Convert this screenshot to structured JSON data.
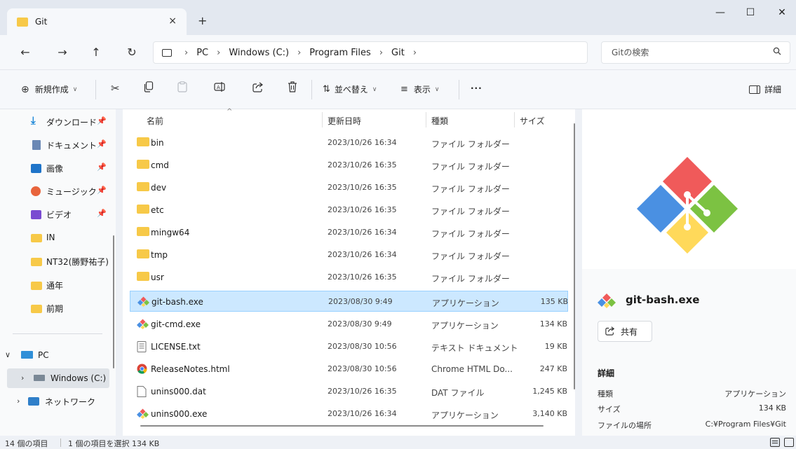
{
  "window": {
    "tab_title": "Git",
    "tab_close": "×",
    "new_tab": "+",
    "minimize": "—",
    "maximize": "☐",
    "close": "✕"
  },
  "nav": {
    "back": "←",
    "forward": "→",
    "up": "↑",
    "refresh": "↻"
  },
  "breadcrumb": [
    "PC",
    "Windows (C:)",
    "Program Files",
    "Git"
  ],
  "search": {
    "placeholder": "Gitの検索"
  },
  "toolbar": {
    "new_label": "新規作成",
    "sort_label": "並べ替え",
    "view_label": "表示",
    "more_label": "···",
    "details_label": "詳細"
  },
  "sidebar": {
    "quick_access": [
      {
        "label": "ダウンロード",
        "icon": "download-icon",
        "pinned": true
      },
      {
        "label": "ドキュメント",
        "icon": "document-icon",
        "pinned": true
      },
      {
        "label": "画像",
        "icon": "pictures-icon",
        "pinned": true
      },
      {
        "label": "ミュージック",
        "icon": "music-icon",
        "pinned": true
      },
      {
        "label": "ビデオ",
        "icon": "video-icon",
        "pinned": true
      },
      {
        "label": "IN",
        "icon": "folder-icon",
        "pinned": false
      },
      {
        "label": "NT32(勝野祐子)",
        "icon": "folder-icon",
        "pinned": false
      },
      {
        "label": "通年",
        "icon": "folder-icon",
        "pinned": false
      },
      {
        "label": "前期",
        "icon": "folder-icon",
        "pinned": false
      }
    ],
    "pc_label": "PC",
    "drive_label": "Windows (C:)",
    "network_label": "ネットワーク"
  },
  "columns": {
    "name": "名前",
    "date": "更新日時",
    "type": "種類",
    "size": "サイズ"
  },
  "files": [
    {
      "name": "bin",
      "date": "2023/10/26 16:34",
      "type": "ファイル フォルダー",
      "size": "",
      "icon": "folder-icon"
    },
    {
      "name": "cmd",
      "date": "2023/10/26 16:35",
      "type": "ファイル フォルダー",
      "size": "",
      "icon": "folder-icon"
    },
    {
      "name": "dev",
      "date": "2023/10/26 16:35",
      "type": "ファイル フォルダー",
      "size": "",
      "icon": "folder-icon"
    },
    {
      "name": "etc",
      "date": "2023/10/26 16:35",
      "type": "ファイル フォルダー",
      "size": "",
      "icon": "folder-icon"
    },
    {
      "name": "mingw64",
      "date": "2023/10/26 16:34",
      "type": "ファイル フォルダー",
      "size": "",
      "icon": "folder-icon"
    },
    {
      "name": "tmp",
      "date": "2023/10/26 16:34",
      "type": "ファイル フォルダー",
      "size": "",
      "icon": "folder-icon"
    },
    {
      "name": "usr",
      "date": "2023/10/26 16:35",
      "type": "ファイル フォルダー",
      "size": "",
      "icon": "folder-icon"
    },
    {
      "name": "git-bash.exe",
      "date": "2023/08/30 9:49",
      "type": "アプリケーション",
      "size": "135 KB",
      "icon": "git-icon",
      "selected": true
    },
    {
      "name": "git-cmd.exe",
      "date": "2023/08/30 9:49",
      "type": "アプリケーション",
      "size": "134 KB",
      "icon": "git-icon"
    },
    {
      "name": "LICENSE.txt",
      "date": "2023/08/30 10:56",
      "type": "テキスト ドキュメント",
      "size": "19 KB",
      "icon": "text-file-icon"
    },
    {
      "name": "ReleaseNotes.html",
      "date": "2023/08/30 10:56",
      "type": "Chrome HTML Do...",
      "size": "247 KB",
      "icon": "chrome-icon"
    },
    {
      "name": "unins000.dat",
      "date": "2023/10/26 16:35",
      "type": "DAT ファイル",
      "size": "1,245 KB",
      "icon": "file-icon"
    },
    {
      "name": "unins000.exe",
      "date": "2023/10/26 16:34",
      "type": "アプリケーション",
      "size": "3,140 KB",
      "icon": "git-icon"
    }
  ],
  "details": {
    "file_name": "git-bash.exe",
    "share_label": "共有",
    "section_title": "詳細",
    "properties": [
      {
        "key": "種類",
        "value": "アプリケーション"
      },
      {
        "key": "サイズ",
        "value": "134 KB"
      },
      {
        "key": "ファイルの場所",
        "value": "C:¥Program Files¥Git"
      }
    ]
  },
  "status": {
    "item_count": "14 個の項目",
    "selection": "1 個の項目を選択 134 KB"
  },
  "colors": {
    "folder": "#f7c948",
    "selection_bg": "#cce8ff",
    "git_red": "#f05a5a",
    "git_green": "#7cc242",
    "git_blue": "#4a90e2",
    "git_yellow": "#ffd95a"
  }
}
